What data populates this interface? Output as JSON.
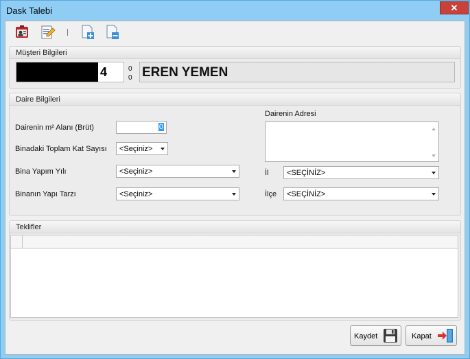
{
  "window": {
    "title": "Dask Talebi",
    "close_glyph": "✕"
  },
  "toolbar": {
    "icons": [
      "customer-card-icon",
      "edit-icon",
      "separator",
      "add-document-icon",
      "remove-document-icon"
    ]
  },
  "musteri": {
    "header": "Müşteri Bilgileri",
    "id_suffix": "4",
    "count_top": "0",
    "count_bottom": "0",
    "name": "EREN YEMEN"
  },
  "daire": {
    "header": "Daire Bilgileri",
    "area_label": "Dairenin m² Alanı (Brüt)",
    "area_value": "0",
    "kat_label": "Binadaki Toplam Kat Sayısı",
    "kat_value": "<Seçiniz>",
    "yapim_label": "Bina Yapım Yılı",
    "yapim_value": "<Seçiniz>",
    "tarz_label": "Binanın Yapı Tarzı",
    "tarz_value": "<Seçiniz>",
    "adres_label": "Dairenin Adresi",
    "adres_value": "",
    "il_label": "İl",
    "il_value": "<SEÇİNİZ>",
    "ilce_label": "İlçe",
    "ilce_value": "<SEÇİNİZ>"
  },
  "teklifler": {
    "header": "Teklifler"
  },
  "buttons": {
    "save": "Kaydet",
    "close": "Kapat"
  },
  "colors": {
    "title_bg": "#8fcdf5",
    "close_red": "#c7423a"
  }
}
